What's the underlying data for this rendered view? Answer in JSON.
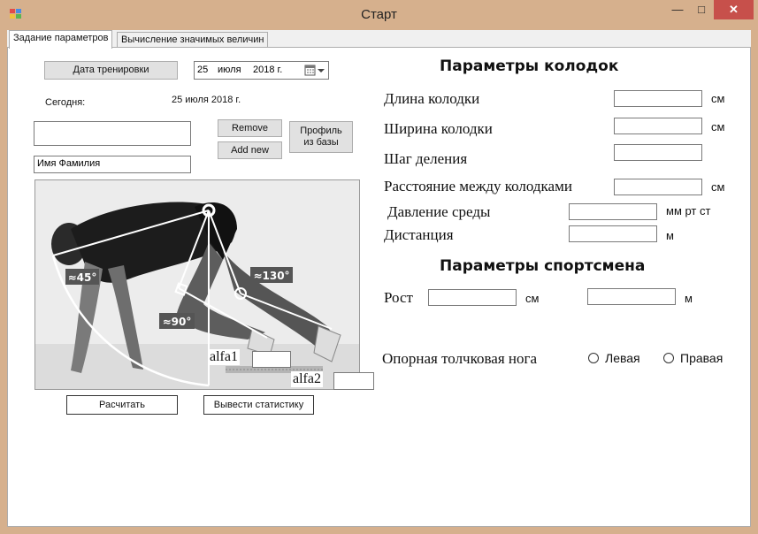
{
  "window": {
    "title": "Старт",
    "minimize": "—",
    "maximize": "□",
    "close": "✕"
  },
  "tabs": [
    {
      "label": "Задание параметров"
    },
    {
      "label": "Вычисление значимых величин"
    }
  ],
  "left": {
    "date_button": "Дата тренировки",
    "date_day": "25",
    "date_month": "июля",
    "date_year": "2018 г.",
    "today_label": "Сегодня:",
    "today_value": "25 июля 2018 г.",
    "name_combo_value": "",
    "name_field_value": "Имя Фамилия",
    "remove_button": "Remove",
    "add_button": "Add new",
    "profile_button": "Профиль\nиз базы",
    "calc_button": "Расчитать",
    "stats_button": "Вывести статистику",
    "angle_45": "≈45°",
    "angle_90": "≈90°",
    "angle_130": "≈130°",
    "alfa1_label": "alfa1",
    "alfa1_value": "",
    "alfa2_label": "alfa2",
    "alfa2_value": ""
  },
  "blocks": {
    "heading": "Параметры колодок",
    "length_label": "Длина колодки",
    "length_unit": "см",
    "length_value": "",
    "width_label": "Ширина колодки",
    "width_unit": "см",
    "width_value": "",
    "step_label": "Шаг деления",
    "step_value": "",
    "distance_between_label": "Расстояние между колодками",
    "distance_between_unit": "см",
    "distance_between_value": "",
    "pressure_label": "Давление среды",
    "pressure_unit": "мм рт ст",
    "pressure_value": "",
    "distance_label": "Дистанция",
    "distance_unit": "м",
    "distance_value": ""
  },
  "athlete": {
    "heading": "Параметры спортсмена",
    "height_label": "Рост",
    "height_unit_cm": "см",
    "height_cm_value": "",
    "height_unit_m": "м",
    "height_m_value": "",
    "leg_label": "Опорная толчковая нога",
    "left_option": "Левая",
    "right_option": "Правая"
  },
  "colors": {
    "window_frame": "#d6b08d",
    "close_button": "#c7504b",
    "angle_label_bg": "#555555"
  }
}
